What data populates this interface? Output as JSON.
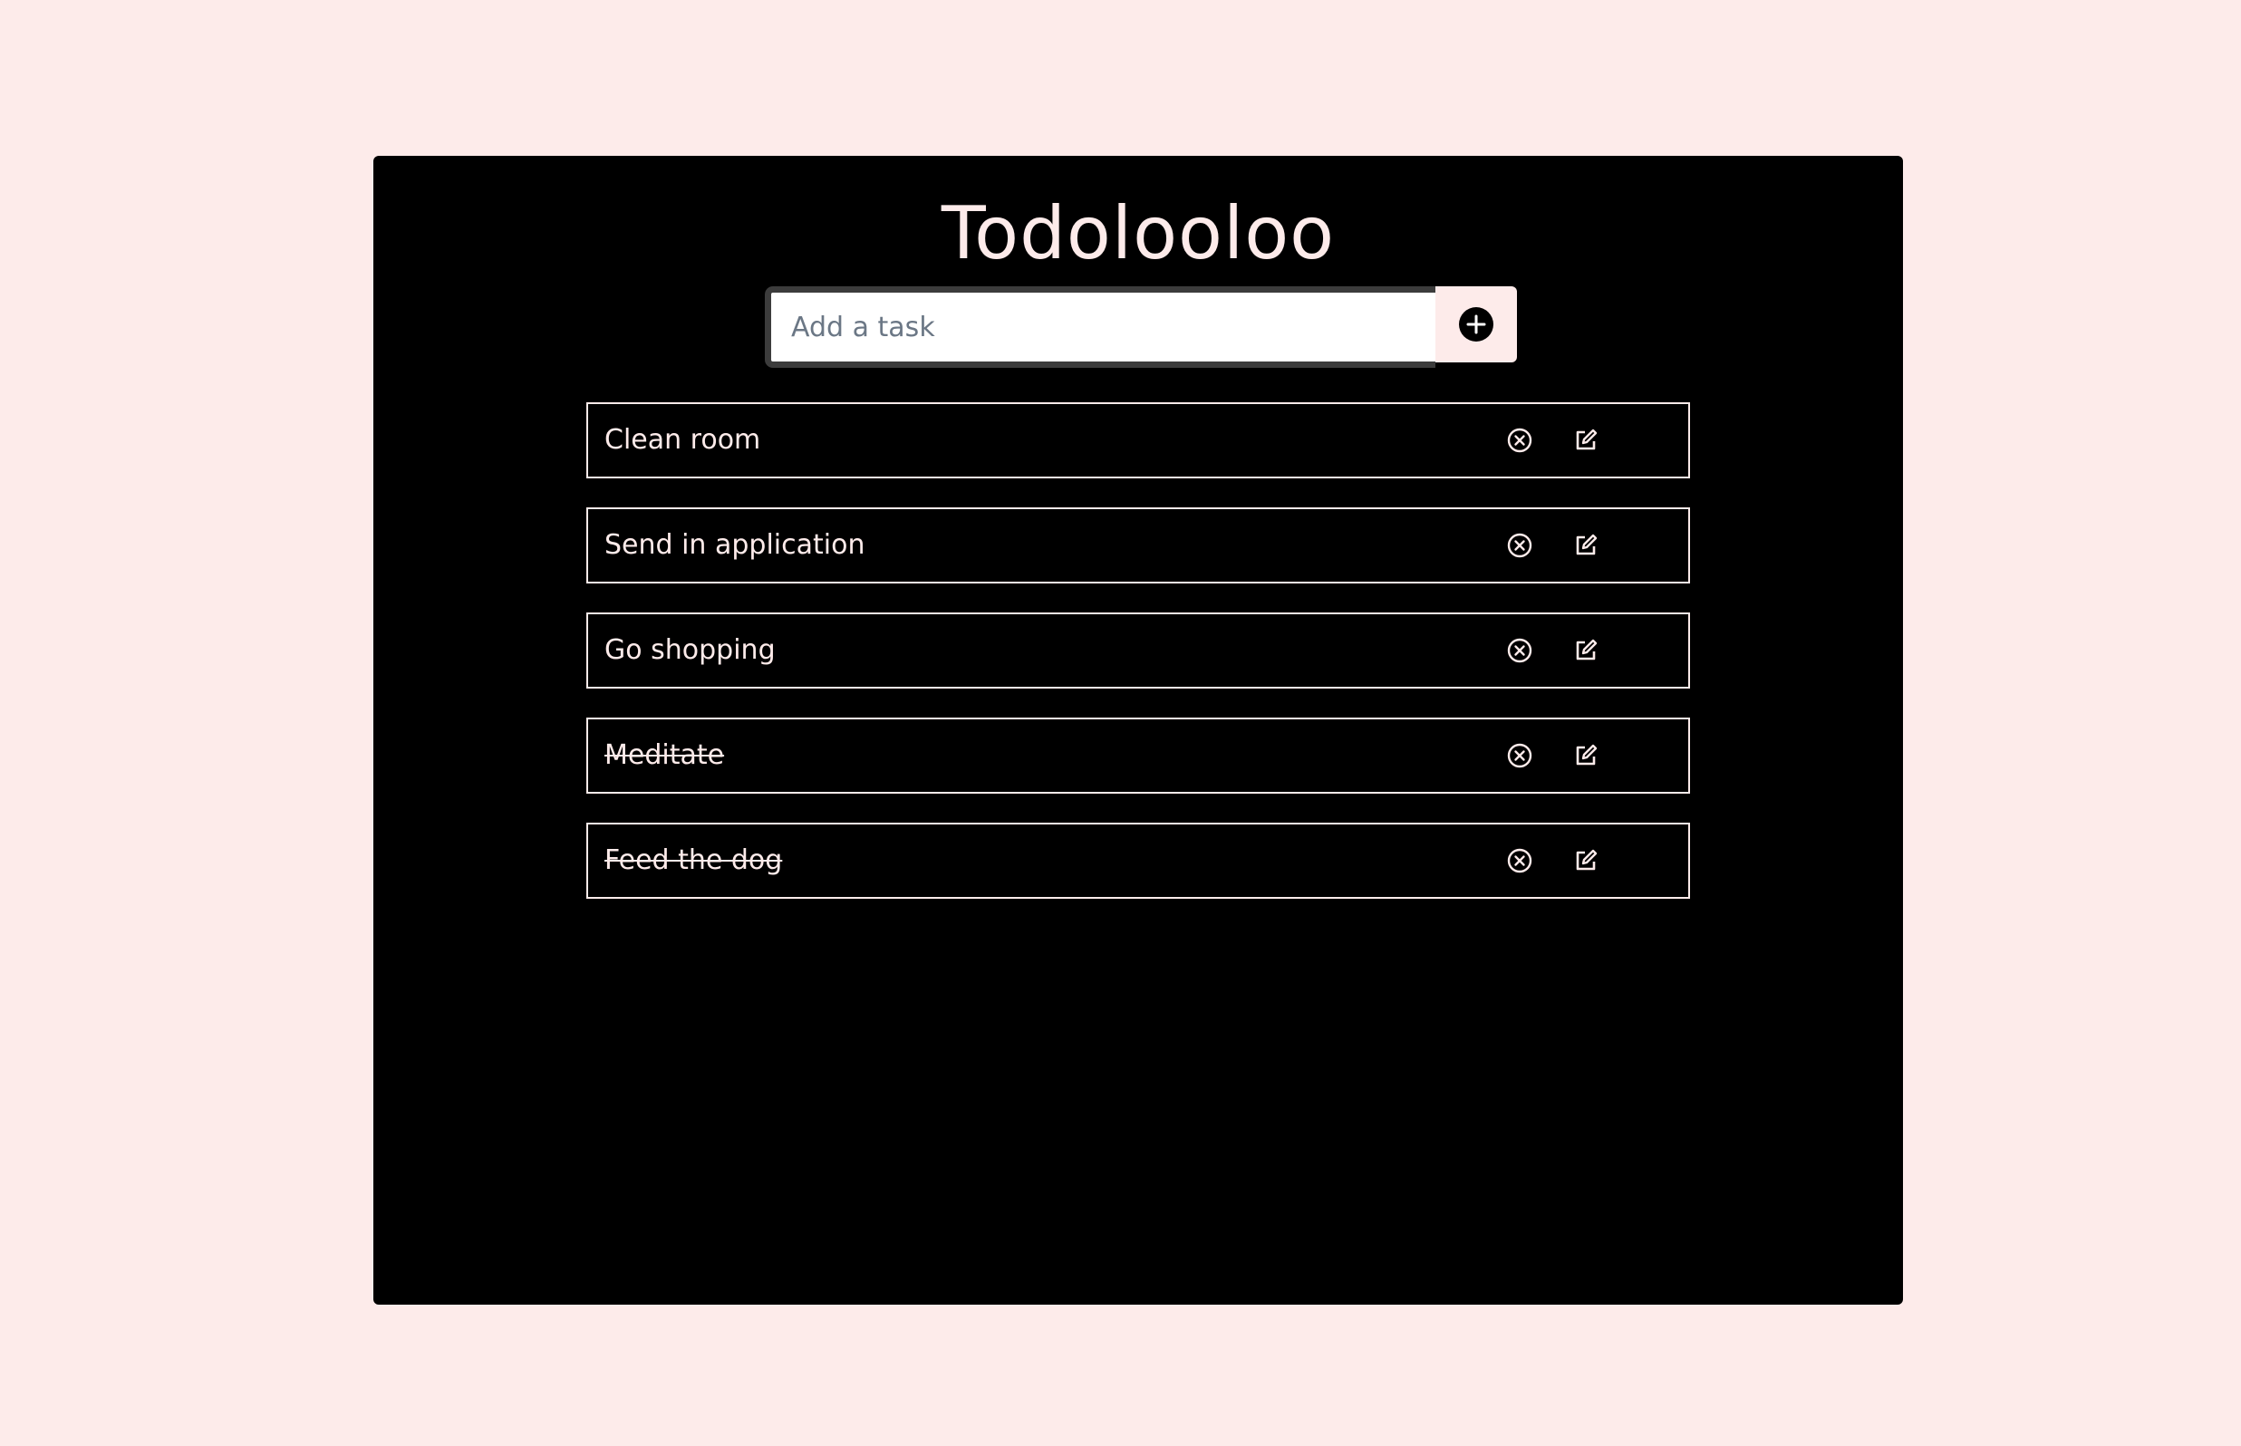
{
  "app": {
    "title": "Todolooloo"
  },
  "add_form": {
    "placeholder": "Add a task",
    "value": "",
    "add_icon": "plus-circle-icon"
  },
  "tasks": [
    {
      "text": "Clean room",
      "completed": false
    },
    {
      "text": "Send in application",
      "completed": false
    },
    {
      "text": "Go shopping",
      "completed": false
    },
    {
      "text": "Meditate",
      "completed": true
    },
    {
      "text": "Feed the dog",
      "completed": true
    }
  ],
  "task_actions": {
    "delete_icon": "circle-x-icon",
    "edit_icon": "edit-square-icon"
  },
  "colors": {
    "page_background": "#fdebea",
    "card_background": "#000000",
    "text": "#fdebea",
    "input_border": "#3c3c3c",
    "placeholder": "#6b7785"
  }
}
